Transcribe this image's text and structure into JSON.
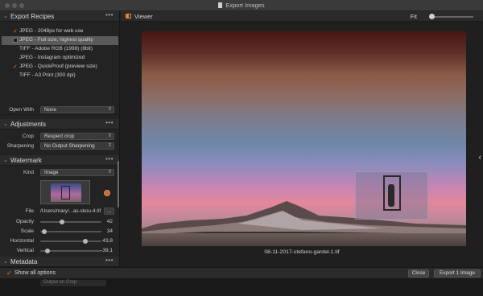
{
  "window": {
    "title": "Export Images"
  },
  "recipes_section": {
    "title": "Export Recipes"
  },
  "recipes": [
    {
      "label": "JPEG - 2048px for web use",
      "checked": true,
      "selected": false
    },
    {
      "label": "JPEG - Full size, highest quality",
      "checked": false,
      "selected": true
    },
    {
      "label": "TIFF - Adobe RGB (1998) (8bit)",
      "checked": false,
      "selected": false
    },
    {
      "label": "JPEG - Instagram optimized",
      "checked": false,
      "selected": false
    },
    {
      "label": "JPEG - QuickProof (preview size)",
      "checked": true,
      "selected": false
    },
    {
      "label": "TIFF - A3 Print (300 dpi)",
      "checked": false,
      "selected": false
    }
  ],
  "open_with": {
    "label": "Open With",
    "value": "None"
  },
  "adjustments": {
    "title": "Adjustments",
    "crop_label": "Crop",
    "crop_value": "Respect crop",
    "sharpening_label": "Sharpening",
    "sharpening_value": "No Output Sharpening"
  },
  "watermark": {
    "title": "Watermark",
    "kind_label": "Kind",
    "kind_value": "Image",
    "file_label": "File",
    "file_value": "/Users/mary/...as-skou-4.tif",
    "file_button": "...",
    "opacity_label": "Opacity",
    "opacity_value": "42",
    "scale_label": "Scale",
    "scale_value": "34",
    "horizontal_label": "Horizontal",
    "horizontal_value": "43,8",
    "vertical_label": "Vertical",
    "vertical_value": "-39,1"
  },
  "metadata": {
    "title": "Metadata"
  },
  "viewer": {
    "title": "Viewer",
    "fit_label": "Fit",
    "filename": "08-11-2017-stefano-gardel-1.tif"
  },
  "bottom": {
    "show_all_options": "Show all options",
    "close": "Close",
    "export": "Export 1 Image"
  },
  "underbar": {
    "value": "Output on Crop"
  },
  "accent_color": "#f0822a",
  "icons": [
    "document-icon",
    "more-icon",
    "plus-icon",
    "minus-icon",
    "chevron-down-icon",
    "viewer-icon",
    "zoom-slider-icon",
    "chevron-left-icon",
    "checkmark-icon"
  ]
}
